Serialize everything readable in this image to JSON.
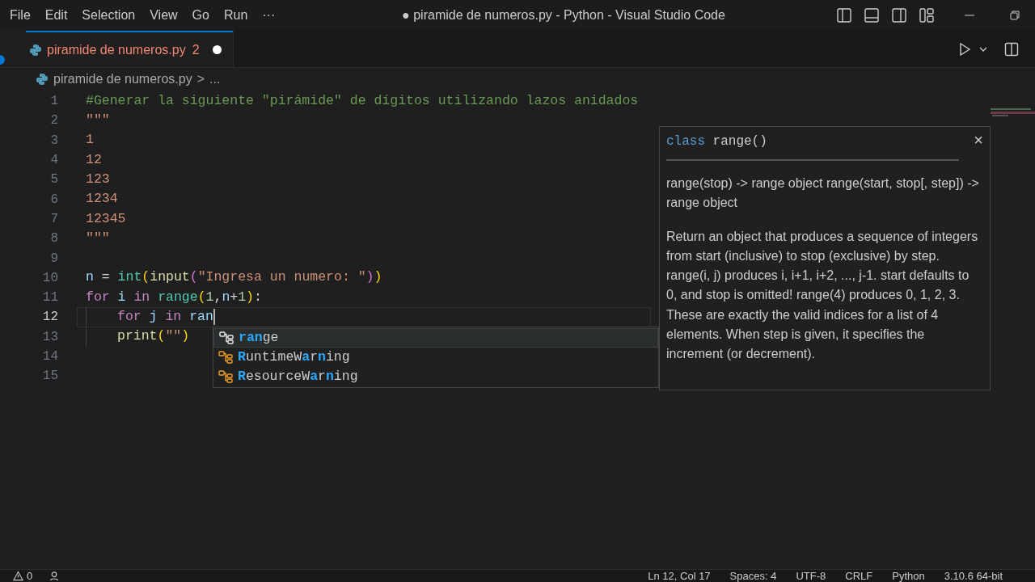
{
  "menu": [
    "File",
    "Edit",
    "Selection",
    "View",
    "Go",
    "Run",
    "···"
  ],
  "window": {
    "title": "● piramide de numeros.py - Python - Visual Studio Code"
  },
  "tabs": [
    {
      "label": "piramide de numeros.py",
      "problems": "2",
      "modified": true,
      "selected": true
    }
  ],
  "breadcrumb": {
    "file": "piramide de numeros.py",
    "separator": ">",
    "more": "..."
  },
  "editor": {
    "lines": [
      {
        "number": "1",
        "current": false,
        "indent": false,
        "tokens": [
          {
            "kind": "comment",
            "text": "#Generar la siguiente \"pirámide\" de dígitos utilizando lazos anidados"
          }
        ]
      },
      {
        "number": "2",
        "current": false,
        "indent": false,
        "tokens": [
          {
            "kind": "string",
            "text": "\"\"\""
          }
        ]
      },
      {
        "number": "3",
        "current": false,
        "indent": false,
        "tokens": [
          {
            "kind": "string",
            "text": "1"
          }
        ]
      },
      {
        "number": "4",
        "current": false,
        "indent": false,
        "tokens": [
          {
            "kind": "string",
            "text": "12"
          }
        ]
      },
      {
        "number": "5",
        "current": false,
        "indent": false,
        "tokens": [
          {
            "kind": "string",
            "text": "123"
          }
        ]
      },
      {
        "number": "6",
        "current": false,
        "indent": false,
        "tokens": [
          {
            "kind": "string",
            "text": "1234"
          }
        ]
      },
      {
        "number": "7",
        "current": false,
        "indent": false,
        "tokens": [
          {
            "kind": "string",
            "text": "12345"
          }
        ]
      },
      {
        "number": "8",
        "current": false,
        "indent": false,
        "tokens": [
          {
            "kind": "string",
            "text": "\"\"\""
          }
        ]
      },
      {
        "number": "9",
        "current": false,
        "indent": false
      },
      {
        "number": "10",
        "current": false,
        "indent": false,
        "tokens": [
          {
            "kind": "variable",
            "text": "n"
          },
          {
            "kind": "plain",
            "text": " ="
          },
          {
            "kind": "class",
            "text": " int"
          },
          {
            "kind": "bracket",
            "text": "("
          },
          {
            "kind": "function",
            "text": "input"
          },
          {
            "kind": "bracket2",
            "text": "("
          },
          {
            "kind": "string",
            "text": "\"Ingresa un numero: \""
          },
          {
            "kind": "bracket2",
            "text": ")"
          },
          {
            "kind": "bracket",
            "text": ")"
          }
        ]
      },
      {
        "number": "11",
        "current": false,
        "indent": false,
        "tokens": [
          {
            "kind": "keyword",
            "text": "for"
          },
          {
            "kind": "variable",
            "text": " i"
          },
          {
            "kind": "keyword",
            "text": " in"
          },
          {
            "kind": "class",
            "text": " range"
          },
          {
            "kind": "bracket",
            "text": "("
          },
          {
            "kind": "number",
            "text": "1"
          },
          {
            "kind": "plain",
            "text": ","
          },
          {
            "kind": "variable",
            "text": "n"
          },
          {
            "kind": "plain",
            "text": "+"
          },
          {
            "kind": "number",
            "text": "1"
          },
          {
            "kind": "bracket",
            "text": ")"
          },
          {
            "kind": "plain",
            "text": ":"
          }
        ]
      },
      {
        "number": "12",
        "current": true,
        "indent": true,
        "tokens": [
          {
            "kind": "keyword",
            "text": "for"
          },
          {
            "kind": "variable",
            "text": " j"
          },
          {
            "kind": "keyword",
            "text": " in"
          },
          {
            "kind": "variable",
            "text": " ran"
          }
        ]
      },
      {
        "number": "13",
        "current": false,
        "indent": true,
        "tokens": [
          {
            "kind": "function",
            "text": "print"
          },
          {
            "kind": "bracket",
            "text": "("
          },
          {
            "kind": "string",
            "text": "\"\""
          },
          {
            "kind": "bracket",
            "text": ")"
          }
        ]
      },
      {
        "number": "14",
        "current": false,
        "indent": false
      },
      {
        "number": "15",
        "current": false,
        "indent": false
      }
    ]
  },
  "suggestions": [
    {
      "selected": true,
      "parts": [
        {
          "text": "ran",
          "match": true
        },
        {
          "text": "ge",
          "match": false
        }
      ]
    },
    {
      "selected": false,
      "parts": [
        {
          "text": "R",
          "match": true
        },
        {
          "text": "untimeW",
          "match": false
        },
        {
          "text": "a",
          "match": true
        },
        {
          "text": "r",
          "match": false
        },
        {
          "text": "n",
          "match": true
        },
        {
          "text": "ing",
          "match": false
        }
      ]
    },
    {
      "selected": false,
      "parts": [
        {
          "text": "R",
          "match": true
        },
        {
          "text": "esourceW",
          "match": false
        },
        {
          "text": "a",
          "match": true
        },
        {
          "text": "r",
          "match": false
        },
        {
          "text": "n",
          "match": true
        },
        {
          "text": "ing",
          "match": false
        }
      ]
    }
  ],
  "hover": {
    "keyword": "class",
    "signature": "range()",
    "close": "×",
    "paragraphs": [
      "range(stop) -> range object range(start, stop[, step]) -> range object",
      "Return an object that produces a sequence of integers from start (inclusive) to stop (exclusive) by step. range(i, j) produces i, i+1, i+2, ..., j-1. start defaults to 0, and stop is omitted! range(4) produces 0, 1, 2, 3. These are exactly the valid indices for a list of 4 elements. When step is given, it specifies the increment (or decrement)."
    ]
  },
  "status_bar": {
    "warnings": "0",
    "items": [
      "Ln 12, Col 17",
      "Spaces: 4",
      "UTF-8",
      "CRLF",
      "Python",
      "3.10.6 64-bit"
    ]
  }
}
